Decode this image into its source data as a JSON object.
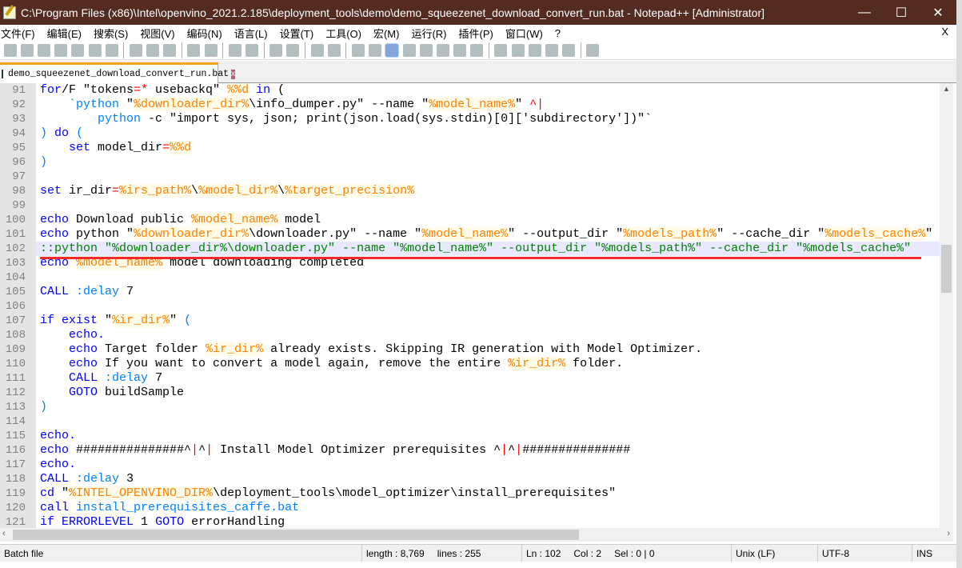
{
  "window": {
    "title": "C:\\Program Files (x86)\\Intel\\openvino_2021.2.185\\deployment_tools\\demo\\demo_squeezenet_download_convert_run.bat - Notepad++ [Administrator]",
    "minimize": "—",
    "maximize": "☐",
    "close": "✕"
  },
  "menu": {
    "items": [
      "文件(F)",
      "编辑(E)",
      "搜索(S)",
      "视图(V)",
      "编码(N)",
      "语言(L)",
      "设置(T)",
      "工具(O)",
      "宏(M)",
      "运行(R)",
      "插件(P)",
      "窗口(W)",
      "?"
    ],
    "close_doc": "X"
  },
  "toolbar": {
    "icons": [
      "new-file-icon",
      "open-file-icon",
      "save-icon",
      "save-all-icon",
      "close-icon",
      "close-all-icon",
      "print-icon",
      "|",
      "cut-icon",
      "copy-icon",
      "paste-icon",
      "|",
      "undo-icon",
      "redo-icon",
      "|",
      "find-icon",
      "replace-icon",
      "|",
      "zoom-in-icon",
      "zoom-out-icon",
      "|",
      "sync-vertical-icon",
      "sync-horizontal-icon",
      "|",
      "word-wrap-icon",
      "show-all-chars-icon",
      "indent-guide-icon",
      "udl-icon",
      "doc-map-icon",
      "function-list-icon",
      "folder-workspace-icon",
      "monitor-icon",
      "|",
      "record-macro-icon",
      "stop-macro-icon",
      "play-macro-icon",
      "run-macro-multiple-icon",
      "save-macro-icon",
      "|",
      "spell-check-icon"
    ],
    "active": "indent-guide-icon"
  },
  "tab": {
    "label": "demo_squeezenet_download_convert_run.bat",
    "close": "x"
  },
  "editor": {
    "current_line": 102,
    "lines": [
      {
        "n": "91",
        "t": [
          [
            "k",
            "for"
          ],
          [
            "",
            "/F \"tokens"
          ],
          [
            "o",
            "=*"
          ],
          [
            "",
            " usebackq\" "
          ],
          [
            "v",
            "%%d"
          ],
          [
            "",
            " "
          ],
          [
            "k",
            "in"
          ],
          [
            "",
            " ("
          ]
        ]
      },
      {
        "n": "92",
        "t": [
          [
            "",
            "    "
          ],
          [
            "l",
            "`python"
          ],
          [
            "",
            " \""
          ],
          [
            "v",
            "%downloader_dir%"
          ],
          [
            "",
            "\\info_dumper.py\" --name \""
          ],
          [
            "v",
            "%model_name%"
          ],
          [
            "",
            "\" "
          ],
          [
            "o",
            "^|"
          ]
        ]
      },
      {
        "n": "93",
        "t": [
          [
            "",
            "        "
          ],
          [
            "l",
            "python"
          ],
          [
            "",
            " -c \"import sys, json; print(json.load(sys.stdin)[0]['subdirectory'])\"`"
          ]
        ]
      },
      {
        "n": "94",
        "t": [
          [
            "l",
            ")"
          ],
          [
            "",
            " "
          ],
          [
            "k",
            "do"
          ],
          [
            "",
            " "
          ],
          [
            "l",
            "("
          ]
        ]
      },
      {
        "n": "95",
        "t": [
          [
            "",
            "    "
          ],
          [
            "k",
            "set"
          ],
          [
            "",
            " model_dir"
          ],
          [
            "o",
            "="
          ],
          [
            "v",
            "%%d"
          ]
        ]
      },
      {
        "n": "96",
        "t": [
          [
            "l",
            ")"
          ]
        ]
      },
      {
        "n": "97",
        "t": []
      },
      {
        "n": "98",
        "t": [
          [
            "k",
            "set"
          ],
          [
            "",
            " ir_dir"
          ],
          [
            "o",
            "="
          ],
          [
            "v",
            "%irs_path%"
          ],
          [
            "",
            "\\"
          ],
          [
            "v",
            "%model_dir%"
          ],
          [
            "",
            "\\"
          ],
          [
            "v",
            "%target_precision%"
          ]
        ]
      },
      {
        "n": "99",
        "t": []
      },
      {
        "n": "100",
        "t": [
          [
            "k",
            "echo"
          ],
          [
            "",
            " Download public "
          ],
          [
            "v",
            "%model_name%"
          ],
          [
            "",
            " model"
          ]
        ]
      },
      {
        "n": "101",
        "t": [
          [
            "k",
            "echo"
          ],
          [
            "",
            " python \""
          ],
          [
            "v",
            "%downloader_dir%"
          ],
          [
            "",
            "\\downloader.py\" --name \""
          ],
          [
            "v",
            "%model_name%"
          ],
          [
            "",
            "\" --output_dir \""
          ],
          [
            "v",
            "%models_path%"
          ],
          [
            "",
            "\" --cache_dir \""
          ],
          [
            "v",
            "%models_cache%"
          ],
          [
            "",
            "\""
          ]
        ]
      },
      {
        "n": "102",
        "t": [
          [
            "c",
            "::python \"%downloader_dir%\\downloader.py\" --name \"%model_name%\" --output_dir \"%models_path%\" --cache_dir \"%models_cache%\""
          ]
        ]
      },
      {
        "n": "103",
        "t": [
          [
            "k",
            "echo"
          ],
          [
            "",
            " "
          ],
          [
            "v",
            "%model_name%"
          ],
          [
            "",
            " model downloading completed"
          ]
        ]
      },
      {
        "n": "104",
        "t": []
      },
      {
        "n": "105",
        "t": [
          [
            "k",
            "CALL"
          ],
          [
            "",
            " "
          ],
          [
            "l",
            ":delay"
          ],
          [
            "",
            " 7"
          ]
        ]
      },
      {
        "n": "106",
        "t": []
      },
      {
        "n": "107",
        "t": [
          [
            "k",
            "if"
          ],
          [
            "",
            " "
          ],
          [
            "k",
            "exist"
          ],
          [
            "",
            " \""
          ],
          [
            "v",
            "%ir_dir%"
          ],
          [
            "",
            "\" "
          ],
          [
            "l",
            "("
          ]
        ]
      },
      {
        "n": "108",
        "t": [
          [
            "",
            "    "
          ],
          [
            "k",
            "echo."
          ]
        ]
      },
      {
        "n": "109",
        "t": [
          [
            "",
            "    "
          ],
          [
            "k",
            "echo"
          ],
          [
            "",
            " Target folder "
          ],
          [
            "v",
            "%ir_dir%"
          ],
          [
            "",
            " already exists. Skipping IR generation with Model Optimizer."
          ]
        ]
      },
      {
        "n": "110",
        "t": [
          [
            "",
            "    "
          ],
          [
            "k",
            "echo"
          ],
          [
            "",
            " If you want to convert a model again, remove the entire "
          ],
          [
            "v",
            "%ir_dir%"
          ],
          [
            "",
            " folder."
          ]
        ]
      },
      {
        "n": "111",
        "t": [
          [
            "",
            "    "
          ],
          [
            "k",
            "CALL"
          ],
          [
            "",
            " "
          ],
          [
            "l",
            ":delay"
          ],
          [
            "",
            " 7"
          ]
        ]
      },
      {
        "n": "112",
        "t": [
          [
            "",
            "    "
          ],
          [
            "k",
            "GOTO"
          ],
          [
            "",
            " buildSample"
          ]
        ]
      },
      {
        "n": "113",
        "t": [
          [
            "l",
            ")"
          ]
        ]
      },
      {
        "n": "114",
        "t": []
      },
      {
        "n": "115",
        "t": [
          [
            "k",
            "echo."
          ]
        ]
      },
      {
        "n": "116",
        "t": [
          [
            "k",
            "echo"
          ],
          [
            "",
            " ###############^"
          ],
          [
            "o",
            "|"
          ],
          [
            "",
            "^"
          ],
          [
            "o",
            "|"
          ],
          [
            "",
            " Install Model Optimizer prerequisites ^"
          ],
          [
            "o",
            "|"
          ],
          [
            "",
            "^"
          ],
          [
            "o",
            "|"
          ],
          [
            "",
            "###############"
          ]
        ]
      },
      {
        "n": "117",
        "t": [
          [
            "k",
            "echo."
          ]
        ]
      },
      {
        "n": "118",
        "t": [
          [
            "k",
            "CALL"
          ],
          [
            "",
            " "
          ],
          [
            "l",
            ":delay"
          ],
          [
            "",
            " 3"
          ]
        ]
      },
      {
        "n": "119",
        "t": [
          [
            "k",
            "cd"
          ],
          [
            "",
            " \""
          ],
          [
            "v",
            "%INTEL_OPENVINO_DIR%"
          ],
          [
            "",
            "\\deployment_tools\\model_optimizer\\install_prerequisites\""
          ]
        ]
      },
      {
        "n": "120",
        "t": [
          [
            "k",
            "call"
          ],
          [
            "",
            " "
          ],
          [
            "l",
            "install_prerequisites_caffe.bat"
          ]
        ]
      },
      {
        "n": "121",
        "t": [
          [
            "k",
            "if"
          ],
          [
            "",
            " "
          ],
          [
            "k",
            "ERRORLEVEL"
          ],
          [
            "",
            " 1 "
          ],
          [
            "k",
            "GOTO"
          ],
          [
            "",
            " errorHandling"
          ]
        ]
      }
    ]
  },
  "status": {
    "file_type": "Batch file",
    "length": "length : 8,769",
    "lines": "lines : 255",
    "ln": "Ln : 102",
    "col": "Col : 2",
    "sel": "Sel : 0 | 0",
    "eol": "Unix (LF)",
    "encoding": "UTF-8",
    "mode": "INS"
  },
  "colors": {
    "titlebar": "#542b21",
    "keyword": "#0000ff",
    "variable": "#ff8000",
    "operator": "#ff0000",
    "comment": "#008000",
    "annotation_underline": "#ee2a2a"
  }
}
